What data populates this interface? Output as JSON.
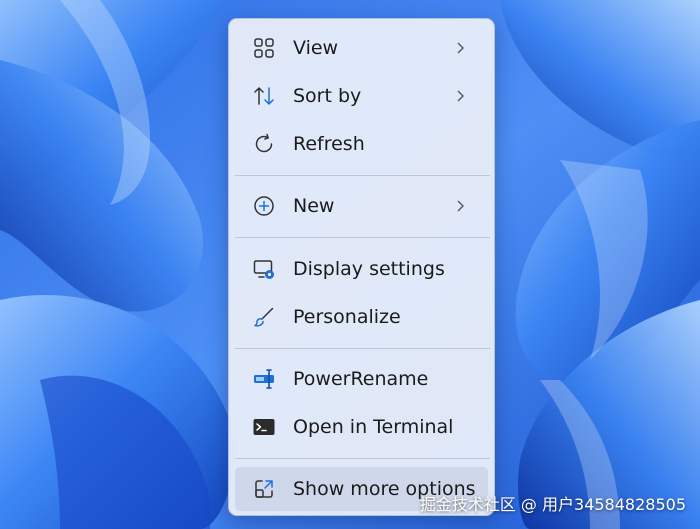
{
  "menu": {
    "items": [
      {
        "label": "View",
        "icon": "grid-view-icon",
        "submenu": true
      },
      {
        "label": "Sort by",
        "icon": "sort-icon",
        "submenu": true
      },
      {
        "label": "Refresh",
        "icon": "refresh-icon",
        "submenu": false
      },
      {
        "label": "New",
        "icon": "plus-circle-icon",
        "submenu": true
      },
      {
        "label": "Display settings",
        "icon": "display-settings-icon",
        "submenu": false
      },
      {
        "label": "Personalize",
        "icon": "brush-icon",
        "submenu": false
      },
      {
        "label": "PowerRename",
        "icon": "powerrename-icon",
        "submenu": false
      },
      {
        "label": "Open in Terminal",
        "icon": "terminal-icon",
        "submenu": false
      },
      {
        "label": "Show more options",
        "icon": "external-link-icon",
        "submenu": false
      }
    ]
  },
  "watermark": "掘金技术社区 @ 用户34584828505",
  "colors": {
    "accent": "#1f6fd6",
    "menu_bg": "#e9eef9",
    "text": "#1b1b1b",
    "wallpaper": "#3a7ef0"
  }
}
